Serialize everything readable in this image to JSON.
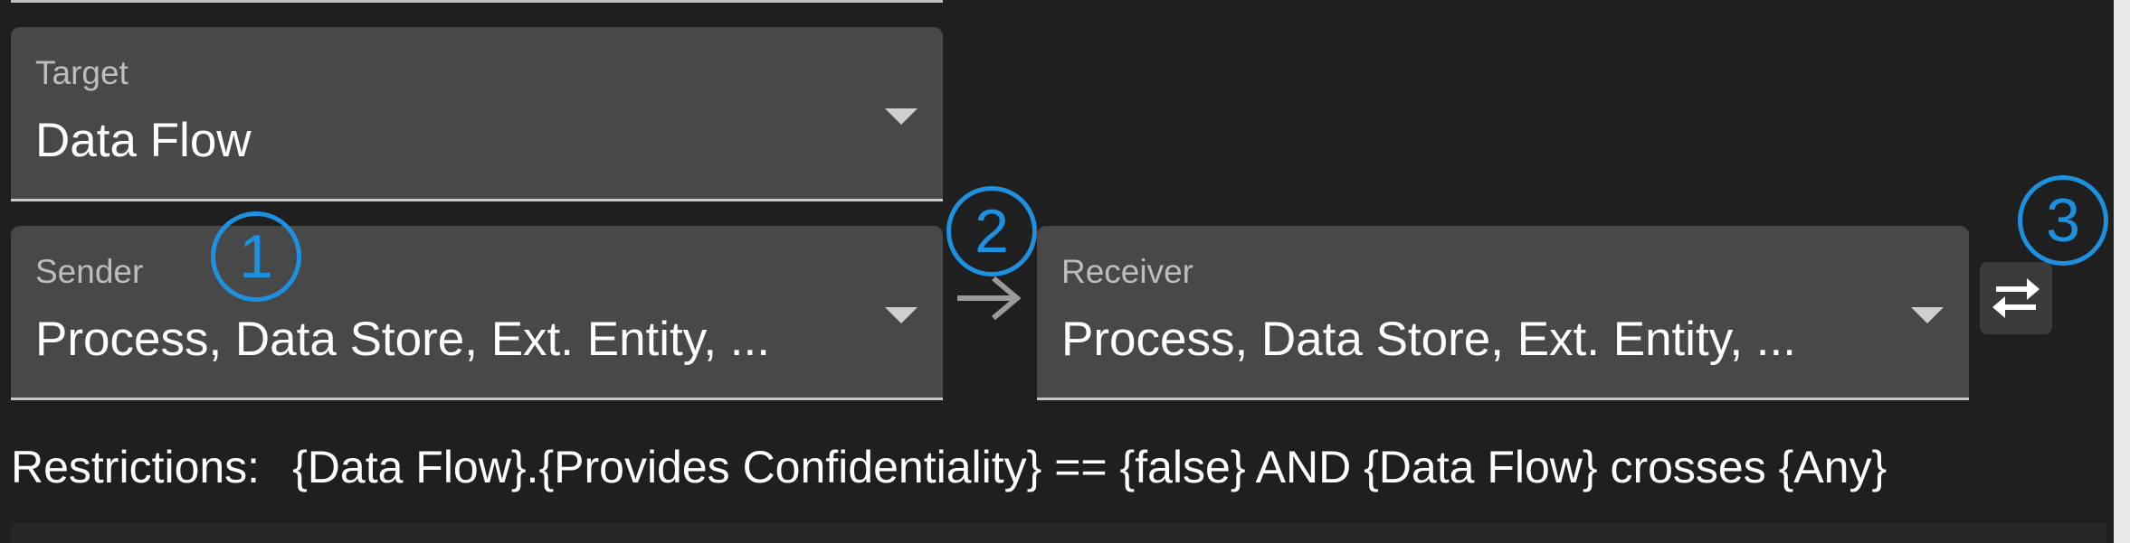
{
  "target": {
    "label": "Target",
    "value": "Data Flow"
  },
  "sender": {
    "label": "Sender",
    "value": "Process, Data Store, Ext. Entity, ..."
  },
  "receiver": {
    "label": "Receiver",
    "value": "Process, Data Store, Ext. Entity, ..."
  },
  "restrictions": {
    "label": "Restrictions:",
    "text": "{Data Flow}.{Provides Confidentiality} == {false} AND {Data Flow} crosses {Any}"
  },
  "markers": [
    "1",
    "2",
    "3"
  ],
  "icons": {
    "direction": "arrow-right-icon",
    "swap": "swap-horizontal-icon",
    "dropdown": "caret-down-icon"
  },
  "colors": {
    "background": "#1f1f1f",
    "field": "#484848",
    "marker": "#1e90e0"
  }
}
